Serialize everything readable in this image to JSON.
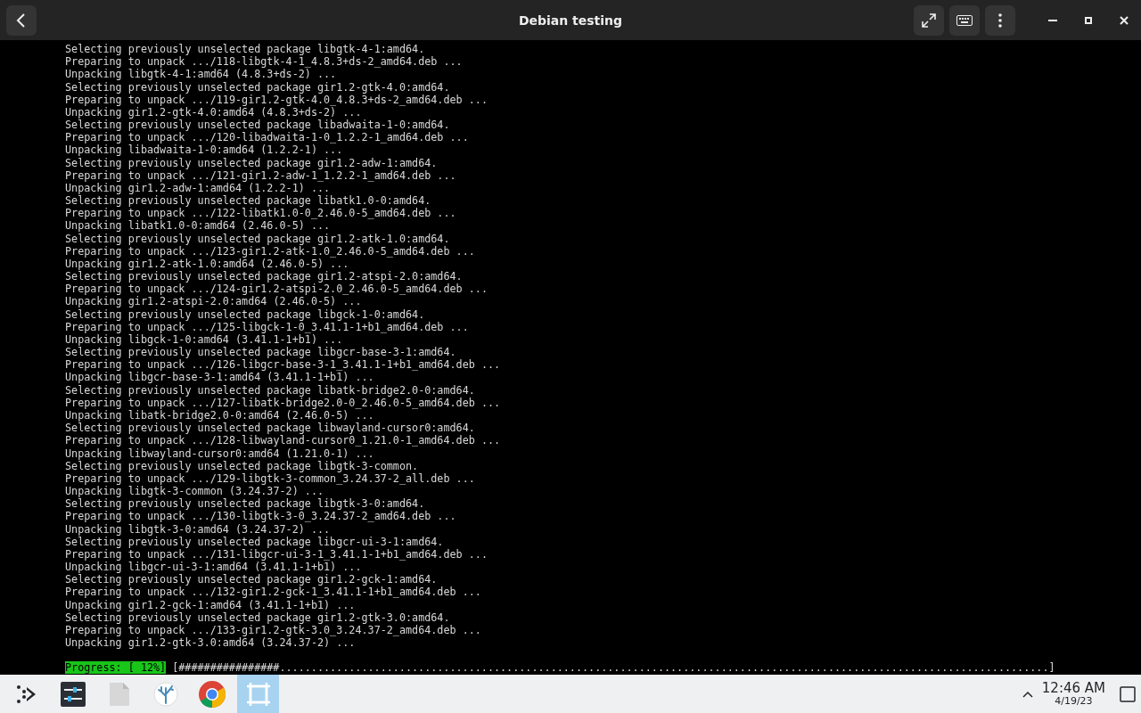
{
  "window": {
    "title": "Debian testing"
  },
  "terminal": {
    "lines": [
      "Selecting previously unselected package libgtk-4-1:amd64.",
      "Preparing to unpack .../118-libgtk-4-1_4.8.3+ds-2_amd64.deb ...",
      "Unpacking libgtk-4-1:amd64 (4.8.3+ds-2) ...",
      "Selecting previously unselected package gir1.2-gtk-4.0:amd64.",
      "Preparing to unpack .../119-gir1.2-gtk-4.0_4.8.3+ds-2_amd64.deb ...",
      "Unpacking gir1.2-gtk-4.0:amd64 (4.8.3+ds-2) ...",
      "Selecting previously unselected package libadwaita-1-0:amd64.",
      "Preparing to unpack .../120-libadwaita-1-0_1.2.2-1_amd64.deb ...",
      "Unpacking libadwaita-1-0:amd64 (1.2.2-1) ...",
      "Selecting previously unselected package gir1.2-adw-1:amd64.",
      "Preparing to unpack .../121-gir1.2-adw-1_1.2.2-1_amd64.deb ...",
      "Unpacking gir1.2-adw-1:amd64 (1.2.2-1) ...",
      "Selecting previously unselected package libatk1.0-0:amd64.",
      "Preparing to unpack .../122-libatk1.0-0_2.46.0-5_amd64.deb ...",
      "Unpacking libatk1.0-0:amd64 (2.46.0-5) ...",
      "Selecting previously unselected package gir1.2-atk-1.0:amd64.",
      "Preparing to unpack .../123-gir1.2-atk-1.0_2.46.0-5_amd64.deb ...",
      "Unpacking gir1.2-atk-1.0:amd64 (2.46.0-5) ...",
      "Selecting previously unselected package gir1.2-atspi-2.0:amd64.",
      "Preparing to unpack .../124-gir1.2-atspi-2.0_2.46.0-5_amd64.deb ...",
      "Unpacking gir1.2-atspi-2.0:amd64 (2.46.0-5) ...",
      "Selecting previously unselected package libgck-1-0:amd64.",
      "Preparing to unpack .../125-libgck-1-0_3.41.1-1+b1_amd64.deb ...",
      "Unpacking libgck-1-0:amd64 (3.41.1-1+b1) ...",
      "Selecting previously unselected package libgcr-base-3-1:amd64.",
      "Preparing to unpack .../126-libgcr-base-3-1_3.41.1-1+b1_amd64.deb ...",
      "Unpacking libgcr-base-3-1:amd64 (3.41.1-1+b1) ...",
      "Selecting previously unselected package libatk-bridge2.0-0:amd64.",
      "Preparing to unpack .../127-libatk-bridge2.0-0_2.46.0-5_amd64.deb ...",
      "Unpacking libatk-bridge2.0-0:amd64 (2.46.0-5) ...",
      "Selecting previously unselected package libwayland-cursor0:amd64.",
      "Preparing to unpack .../128-libwayland-cursor0_1.21.0-1_amd64.deb ...",
      "Unpacking libwayland-cursor0:amd64 (1.21.0-1) ...",
      "Selecting previously unselected package libgtk-3-common.",
      "Preparing to unpack .../129-libgtk-3-common_3.24.37-2_all.deb ...",
      "Unpacking libgtk-3-common (3.24.37-2) ...",
      "Selecting previously unselected package libgtk-3-0:amd64.",
      "Preparing to unpack .../130-libgtk-3-0_3.24.37-2_amd64.deb ...",
      "Unpacking libgtk-3-0:amd64 (3.24.37-2) ...",
      "Selecting previously unselected package libgcr-ui-3-1:amd64.",
      "Preparing to unpack .../131-libgcr-ui-3-1_3.41.1-1+b1_amd64.deb ...",
      "Unpacking libgcr-ui-3-1:amd64 (3.41.1-1+b1) ...",
      "Selecting previously unselected package gir1.2-gck-1:amd64.",
      "Preparing to unpack .../132-gir1.2-gck-1_3.41.1-1+b1_amd64.deb ...",
      "Unpacking gir1.2-gck-1:amd64 (3.41.1-1+b1) ...",
      "Selecting previously unselected package gir1.2-gtk-3.0:amd64.",
      "Preparing to unpack .../133-gir1.2-gtk-3.0_3.24.37-2_amd64.deb ...",
      "Unpacking gir1.2-gtk-3.0:amd64 (3.24.37-2) ..."
    ],
    "progress_label": "Progress: [ 12%]",
    "progress_bar": "[################..........................................................................................................................]"
  },
  "taskbar": {
    "apps": [
      {
        "kind": "launcher",
        "selected": false
      },
      {
        "kind": "settings",
        "selected": false
      },
      {
        "kind": "files",
        "selected": false
      },
      {
        "kind": "coral",
        "selected": false
      },
      {
        "kind": "browser",
        "selected": false
      },
      {
        "kind": "terminal",
        "selected": true
      }
    ],
    "time": "12:46 AM",
    "date": "4/19/23"
  }
}
